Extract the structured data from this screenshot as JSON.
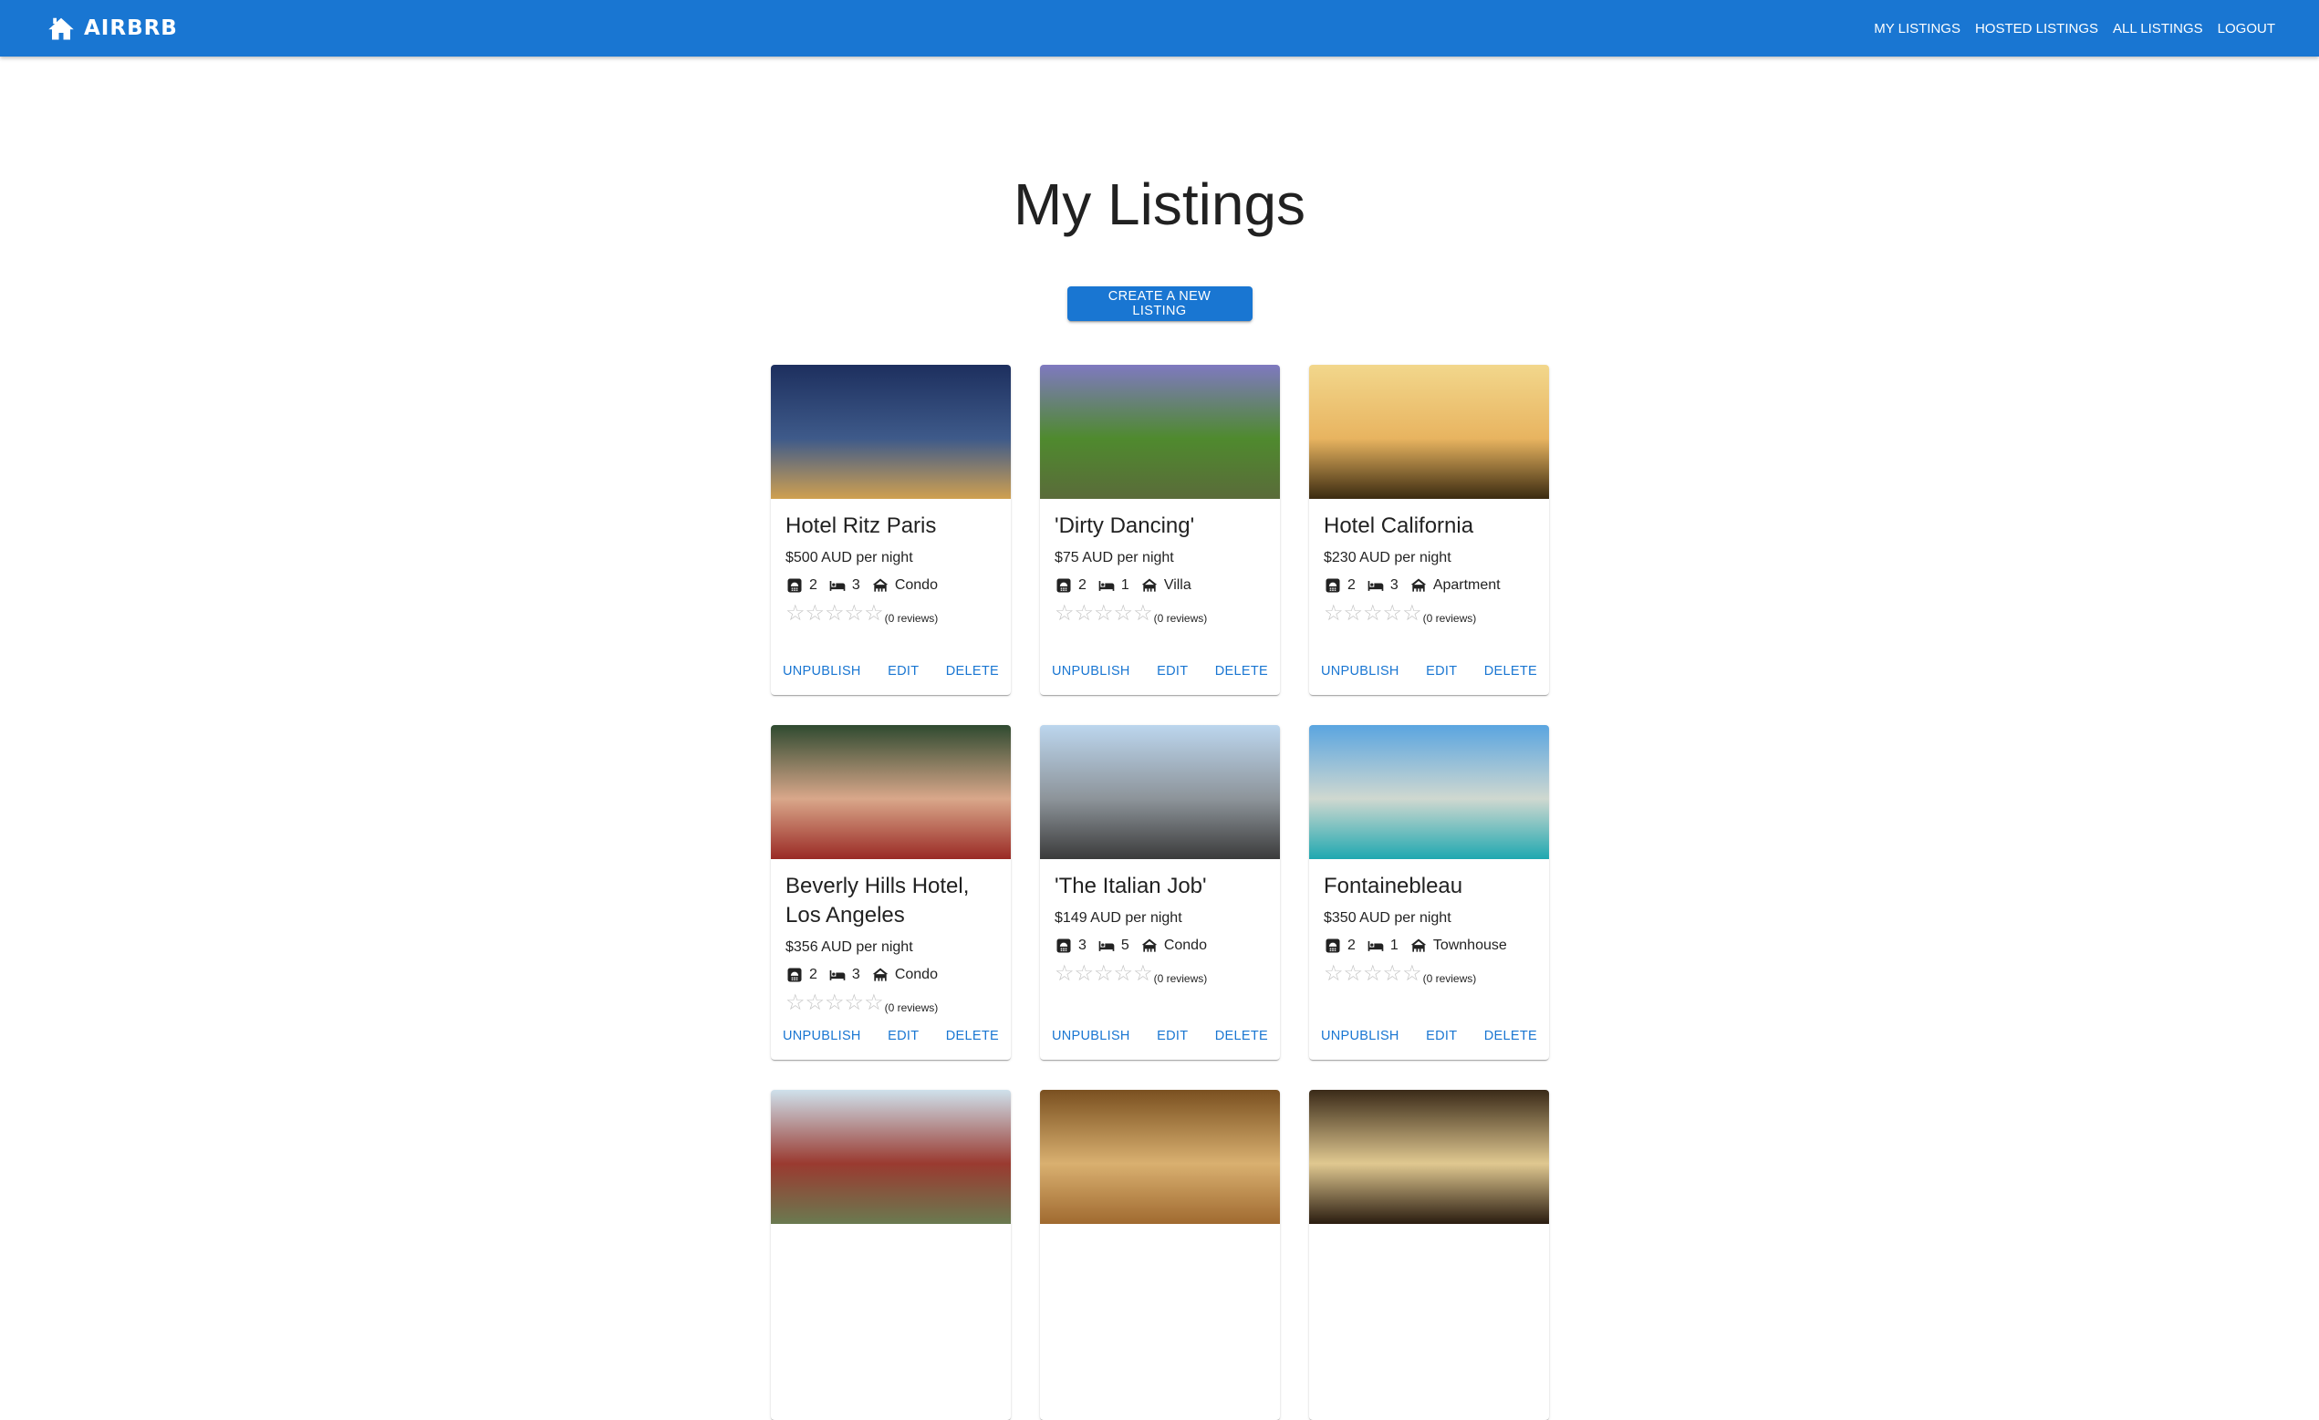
{
  "nav": {
    "brand": "AIRBRB",
    "links": [
      "MY LISTINGS",
      "HOSTED LISTINGS",
      "ALL LISTINGS",
      "LOGOUT"
    ]
  },
  "page": {
    "title": "My Listings",
    "create_button": "CREATE A NEW LISTING"
  },
  "card_actions": {
    "unpublish": "UNPUBLISH",
    "edit": "EDIT",
    "delete": "DELETE"
  },
  "listings": [
    {
      "title": "Hotel Ritz Paris",
      "price": "$500 AUD per night",
      "bathrooms": "2",
      "bedrooms": "3",
      "type": "Condo",
      "rating": 0,
      "reviews": "(0 reviews)",
      "image_colors": [
        "#1d2f5e",
        "#3e5a8a",
        "#d0a050"
      ]
    },
    {
      "title": "'Dirty Dancing'",
      "price": "$75 AUD per night",
      "bathrooms": "2",
      "bedrooms": "1",
      "type": "Villa",
      "rating": 0,
      "reviews": "(0 reviews)",
      "image_colors": [
        "#7f79c0",
        "#4f8a2e",
        "#5a6b3a"
      ]
    },
    {
      "title": "Hotel California",
      "price": "$230 AUD per night",
      "bathrooms": "2",
      "bedrooms": "3",
      "type": "Apartment",
      "rating": 0,
      "reviews": "(0 reviews)",
      "image_colors": [
        "#f2d78c",
        "#e8b460",
        "#3a2a10"
      ]
    },
    {
      "title": "Beverly Hills Hotel, Los Angeles",
      "price": "$356 AUD per night",
      "bathrooms": "2",
      "bedrooms": "3",
      "type": "Condo",
      "rating": 0,
      "reviews": "(0 reviews)",
      "image_colors": [
        "#2f4a30",
        "#d9a78a",
        "#9a2a25"
      ]
    },
    {
      "title": "'The Italian Job'",
      "price": "$149 AUD per night",
      "bathrooms": "3",
      "bedrooms": "5",
      "type": "Condo",
      "rating": 0,
      "reviews": "(0 reviews)",
      "image_colors": [
        "#bcd6ee",
        "#8d949a",
        "#3b3b3b"
      ]
    },
    {
      "title": "Fontainebleau",
      "price": "$350 AUD per night",
      "bathrooms": "2",
      "bedrooms": "1",
      "type": "Townhouse",
      "rating": 0,
      "reviews": "(0 reviews)",
      "image_colors": [
        "#5aa5e0",
        "#cfd8d0",
        "#1fa8b0"
      ]
    },
    {
      "title": "",
      "price": "",
      "bathrooms": "",
      "bedrooms": "",
      "type": "",
      "rating": 0,
      "reviews": "",
      "image_colors": [
        "#cfe1ec",
        "#9a3a30",
        "#6a7a50"
      ]
    },
    {
      "title": "",
      "price": "",
      "bathrooms": "",
      "bedrooms": "",
      "type": "",
      "rating": 0,
      "reviews": "",
      "image_colors": [
        "#7a5020",
        "#d9b070",
        "#a06a30"
      ]
    },
    {
      "title": "",
      "price": "",
      "bathrooms": "",
      "bedrooms": "",
      "type": "",
      "rating": 0,
      "reviews": "",
      "image_colors": [
        "#3a2a18",
        "#e0c890",
        "#2a1c10"
      ]
    }
  ]
}
